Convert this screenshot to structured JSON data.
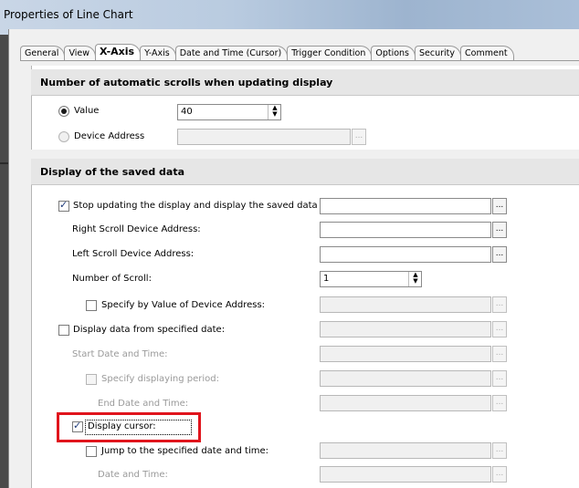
{
  "window": {
    "title": "Properties of Line Chart"
  },
  "tabs": [
    "General",
    "View",
    "X-Axis",
    "Y-Axis",
    "Date and Time (Cursor)",
    "Trigger Condition",
    "Options",
    "Security",
    "Comment"
  ],
  "section1": {
    "title": "Number of automatic scrolls when updating display",
    "value_label": "Value",
    "value": "40",
    "device_label": "Device Address",
    "device_value": "",
    "ellipsis": "..."
  },
  "section2": {
    "title": "Display of the saved data",
    "stop_updating": "Stop updating the display and display the saved data",
    "right_scroll": "Right Scroll Device Address:",
    "left_scroll": "Left Scroll Device Address:",
    "num_scroll": "Number of Scroll:",
    "num_scroll_value": "1",
    "specify_value": "Specify by Value of Device Address:",
    "display_from_date": "Display data from specified date:",
    "start_datetime": "Start Date and Time:",
    "specify_period": "Specify displaying period:",
    "end_datetime": "End Date and Time:",
    "display_cursor": "Display cursor:",
    "jump_to": "Jump to the specified date and time:",
    "date_time": "Date and Time:",
    "ellipsis": "..."
  },
  "state": {
    "value_selected": true,
    "stop_updating_checked": true,
    "display_cursor_checked": true
  }
}
